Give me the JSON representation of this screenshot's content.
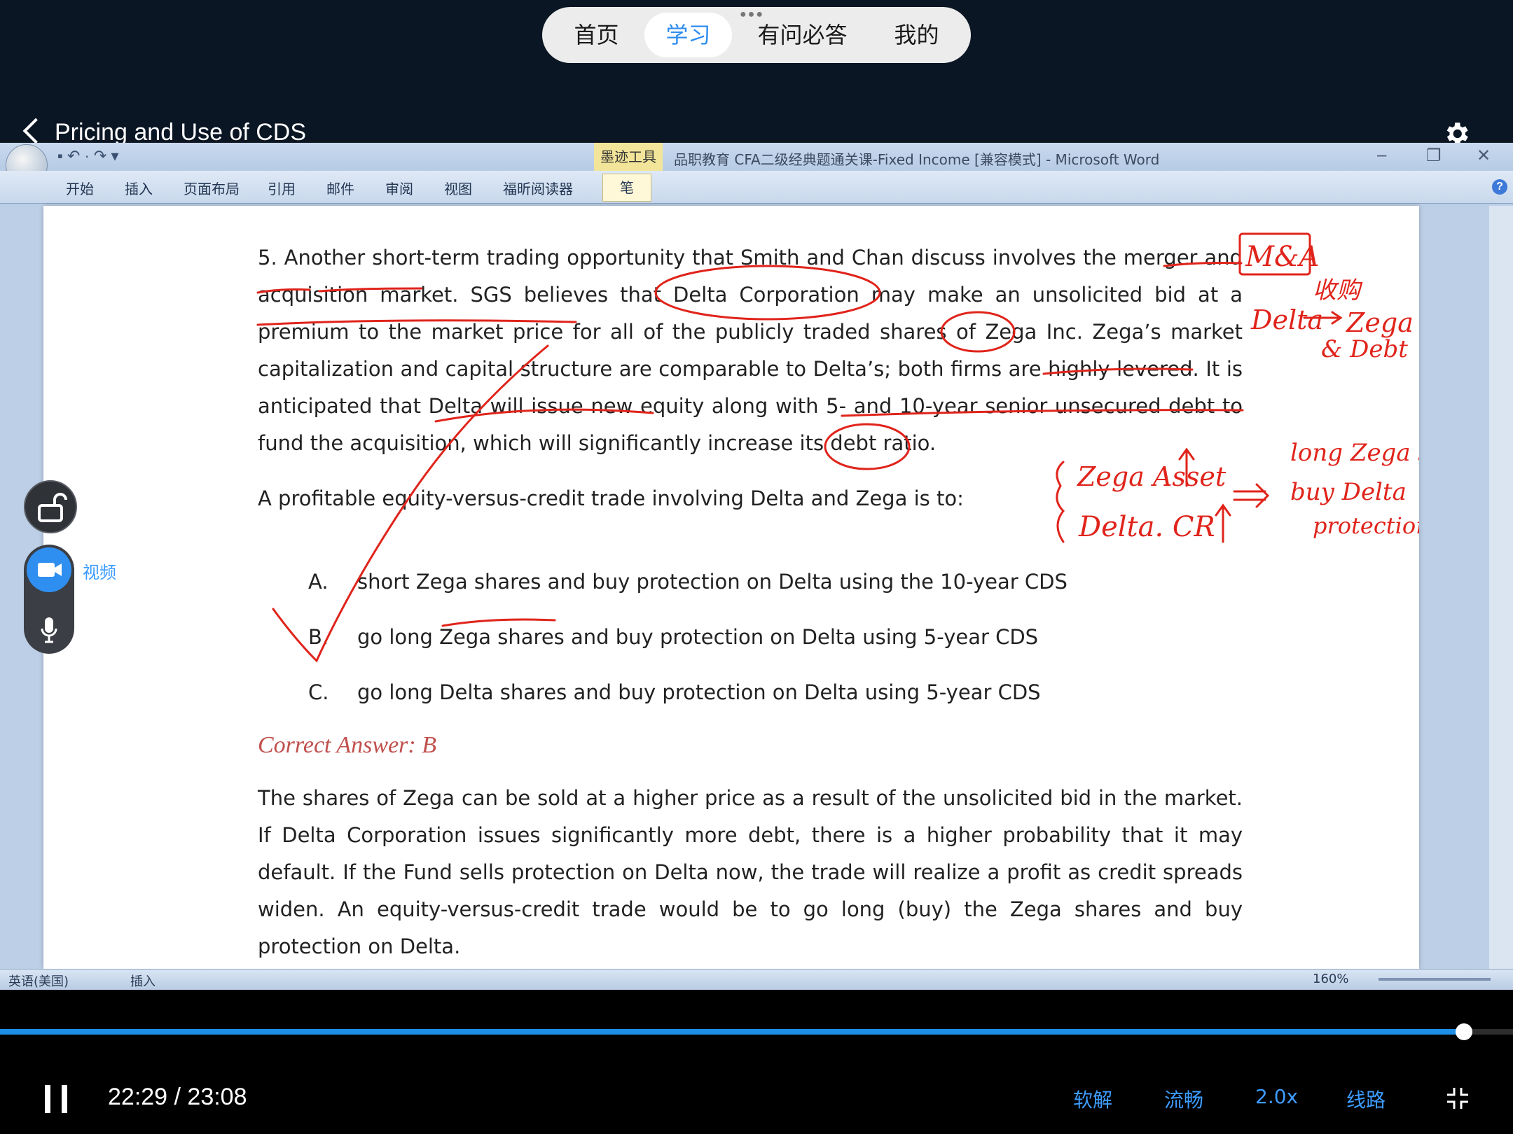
{
  "top_nav": {
    "tabs": [
      {
        "label": "首页"
      },
      {
        "label": "学习"
      },
      {
        "label": "有问必答"
      },
      {
        "label": "我的"
      }
    ],
    "active_index": 1
  },
  "video": {
    "title": "Pricing and Use of CDS"
  },
  "word": {
    "ink_tools_label": "墨迹工具",
    "document_title": "品职教育 CFA二级经典题通关课-Fixed Income [兼容模式] - Microsoft Word",
    "ribbon_tabs": [
      "开始",
      "插入",
      "页面布局",
      "引用",
      "邮件",
      "审阅",
      "视图",
      "福昕阅读器"
    ],
    "pen_tab": "笔",
    "status_language": "英语(美国)",
    "status_mode": "插入",
    "zoom": "160%"
  },
  "document": {
    "question": "5.   Another short-term trading opportunity that Smith and Chan discuss involves the merger and acquisition market. SGS believes that Delta Corporation may make an unsolicited bid at a premium to the market price for all of the publicly traded shares of Zega Inc. Zega’s market capitalization and capital structure are comparable to Delta’s; both firms are highly levered. It is anticipated that Delta will issue new equity along with 5- and 10-year senior unsecured debt to fund the acquisition, which will significantly increase its debt ratio.",
    "lead": "A profitable equity-versus-credit trade involving Delta and Zega is to:",
    "options": [
      {
        "letter": "A.",
        "text": "short Zega shares and buy protection on Delta using the 10-year CDS"
      },
      {
        "letter": "B.",
        "text": "go long Zega shares and buy protection  on Delta using 5-year CDS"
      },
      {
        "letter": "C.",
        "text": "go long Delta shares and buy protection on Delta using 5-year CDS"
      }
    ],
    "correct_answer": "Correct Answer: B",
    "explanation": "The shares of Zega can be sold at a higher price as a result of the unsolicited bid in the market. If Delta Corporation issues significantly more debt, there is a higher probability that it may default. If the Fund sells protection on Delta now, the trade will realize a profit as credit spreads widen. An equity-versus-credit trade would be to go long (buy) the Zega shares and buy protection on Delta."
  },
  "annotations": {
    "note_ma": "M&A",
    "note_chinese": "收购",
    "note_delta": "Delta",
    "note_zega": "Zega",
    "note_debt": "& Debt",
    "note_zega_assets": "Zega Asset",
    "note_delta_cr": "Delta. CR",
    "note_long_zega": "long Zega shares",
    "note_buy_delta": "buy Delta",
    "note_protection": "protection",
    "ink_color": "#e0241b"
  },
  "side_controls": {
    "video_label": "视频"
  },
  "player": {
    "time": "22:29 / 23:08",
    "progress": 0.9676,
    "controls": [
      "软解",
      "流畅",
      "2.0x",
      "线路"
    ],
    "accent": "#1e8de6"
  }
}
